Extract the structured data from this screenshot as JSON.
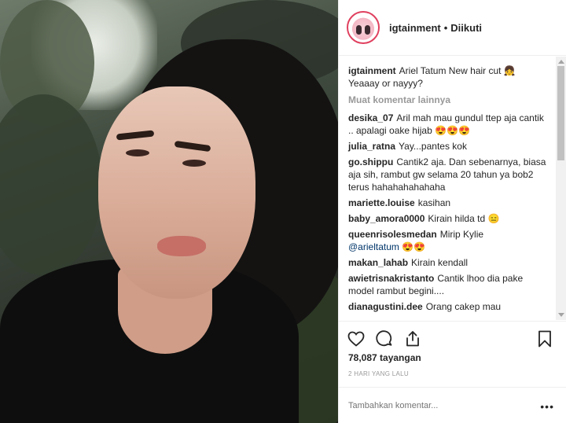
{
  "header": {
    "username": "igtainment",
    "separator": "•",
    "follow_label": "Diikuti"
  },
  "caption": {
    "username": "igtainment",
    "text": "Ariel Tatum New hair cut 👧 Yeaaay or nayyy?"
  },
  "more_comments": "Muat komentar lainnya",
  "comments": [
    {
      "user": "desika_07",
      "text": "Aril mah mau gundul ttep aja cantik .. apalagi oake hijab 😍😍😍"
    },
    {
      "user": "julia_ratna",
      "text": "Yay...pantes kok"
    },
    {
      "user": "go.shippu",
      "text": "Cantik2 aja. Dan sebenarnya, biasa aja sih, rambut gw selama 20 tahun ya bob2 terus hahahahahahaha"
    },
    {
      "user": "mariette.louise",
      "text": "kasihan"
    },
    {
      "user": "baby_amora0000",
      "text": "Kirain hilda td 😑"
    },
    {
      "user": "queenrisolesmedan",
      "text": "Mirip Kylie",
      "mention": "@arieltatum",
      "after": " 😍😍"
    },
    {
      "user": "makan_lahab",
      "text": "Kirain kendall"
    },
    {
      "user": "awietrisnakristanto",
      "text": "Cantik lhoo dia pake model rambut begini...."
    },
    {
      "user": "dianagustini.dee",
      "text": "Orang cakep mau"
    }
  ],
  "stats": {
    "views": "78,087 tayangan",
    "date": "2 HARI YANG LALU"
  },
  "add_comment": {
    "placeholder": "Tambahkan komentar...",
    "more": "•••"
  },
  "icons": [
    "heart-icon",
    "comment-icon",
    "share-icon",
    "bookmark-icon"
  ]
}
